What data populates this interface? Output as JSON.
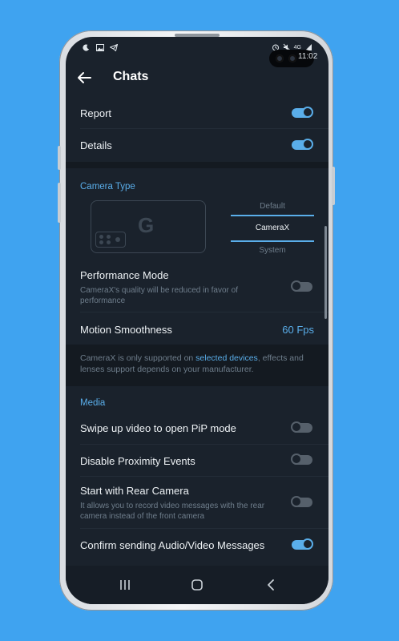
{
  "status": {
    "time": "11:02",
    "indicators": [
      "moon-icon",
      "image-icon",
      "telegram-icon"
    ],
    "right_icons": [
      "alarm-icon",
      "mute-icon",
      "4g-icon",
      "signal-icon",
      "battery-icon"
    ],
    "network_label": "4G"
  },
  "header": {
    "title": "Chats"
  },
  "top_rows": [
    {
      "label": "Report",
      "on": true
    },
    {
      "label": "Details",
      "on": true
    }
  ],
  "camera": {
    "section_label": "Camera Type",
    "card_logo": "G",
    "options": [
      "Default",
      "CameraX",
      "System"
    ],
    "selected": "CameraX"
  },
  "performance": {
    "label": "Performance Mode",
    "description": "CameraX's quality will be reduced in favor of performance",
    "on": false
  },
  "motion": {
    "label": "Motion Smoothness",
    "value": "60 Fps"
  },
  "info": {
    "prefix": "CameraX is only supported on ",
    "link": "selected devices",
    "suffix": ", effects and lenses support depends on your manufacturer."
  },
  "media": {
    "section_label": "Media",
    "rows": [
      {
        "label": "Swipe up video to open PiP mode",
        "on": false
      },
      {
        "label": "Disable Proximity Events",
        "on": false
      },
      {
        "label": "Start with Rear Camera",
        "description": "It allows you to record video messages with the rear camera instead of the front camera",
        "on": false
      },
      {
        "label": "Confirm sending Audio/Video Messages",
        "on": true
      }
    ]
  },
  "nav": [
    "recents-icon",
    "home-icon",
    "back-icon"
  ],
  "colors": {
    "accent": "#5aaeea",
    "background": "#1a222c",
    "wallpaper": "#3fa3f0"
  }
}
